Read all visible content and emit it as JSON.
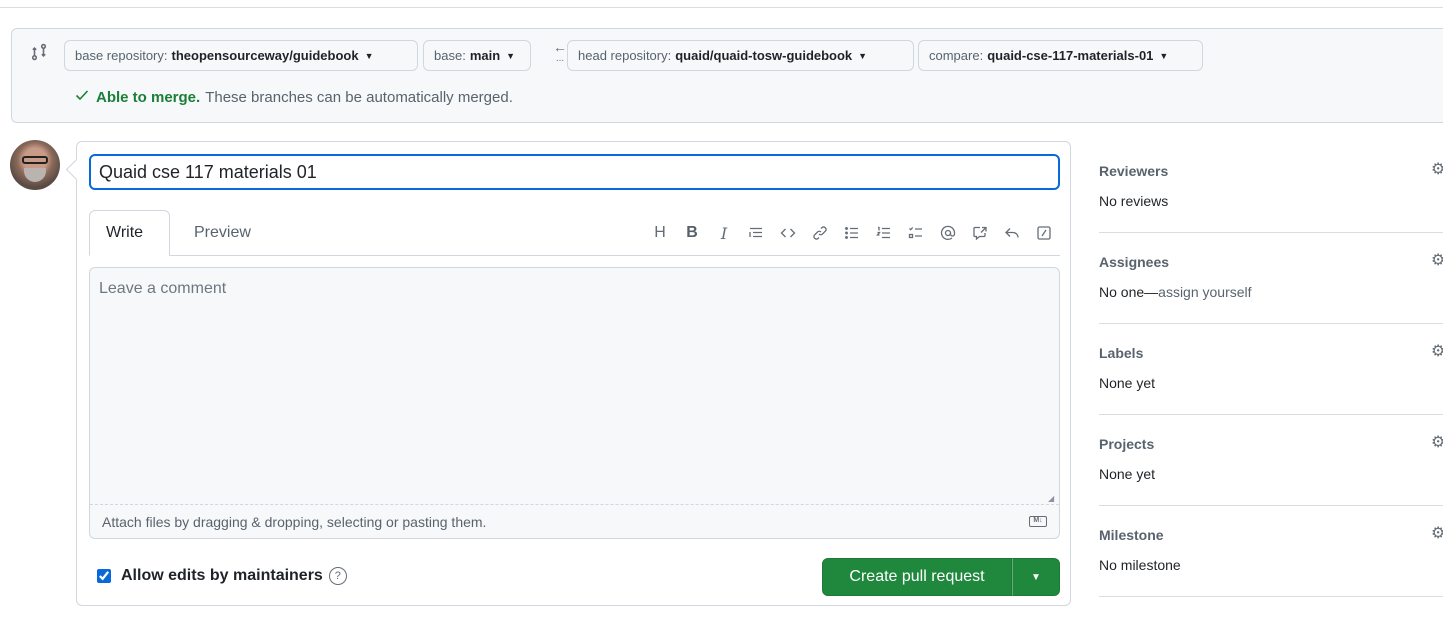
{
  "compare": {
    "base_repo_label": "base repository:",
    "base_repo_value": "theopensourceway/guidebook",
    "base_label": "base:",
    "base_value": "main",
    "arrow": "←",
    "arrow_dots": "...",
    "head_repo_label": "head repository:",
    "head_repo_value": "quaid/quaid-tosw-guidebook",
    "compare_label": "compare:",
    "compare_value": "quaid-cse-117-materials-01",
    "merge_ok": "Able to merge.",
    "merge_desc": "These branches can be automatically merged."
  },
  "editor": {
    "title_value": "Quaid cse 117 materials 01",
    "tab_write": "Write",
    "tab_preview": "Preview",
    "comment_placeholder": "Leave a comment",
    "attach_text": "Attach files by dragging & dropping, selecting or pasting them.",
    "md_badge": "M↓",
    "allow_edits_label": "Allow edits by maintainers",
    "allow_edits_checked": true,
    "create_button": "Create pull request"
  },
  "toolbar": [
    "heading-icon",
    "bold-icon",
    "italic-icon",
    "quote-icon",
    "code-icon",
    "link-icon",
    "unordered-list-icon",
    "ordered-list-icon",
    "task-list-icon",
    "mention-icon",
    "cross-reference-icon",
    "saved-reply-icon",
    "slash-command-icon"
  ],
  "sidebar": {
    "reviewers_title": "Reviewers",
    "reviewers_value": "No reviews",
    "assignees_title": "Assignees",
    "assignees_value": "No one—",
    "assignees_link": "assign yourself",
    "labels_title": "Labels",
    "labels_value": "None yet",
    "projects_title": "Projects",
    "projects_value": "None yet",
    "milestone_title": "Milestone",
    "milestone_value": "No milestone"
  },
  "colors": {
    "accent_blue": "#0969da",
    "success_green": "#1a7f37",
    "button_green": "#1f883d",
    "muted_text": "#59636e",
    "border": "#d0d7de"
  }
}
